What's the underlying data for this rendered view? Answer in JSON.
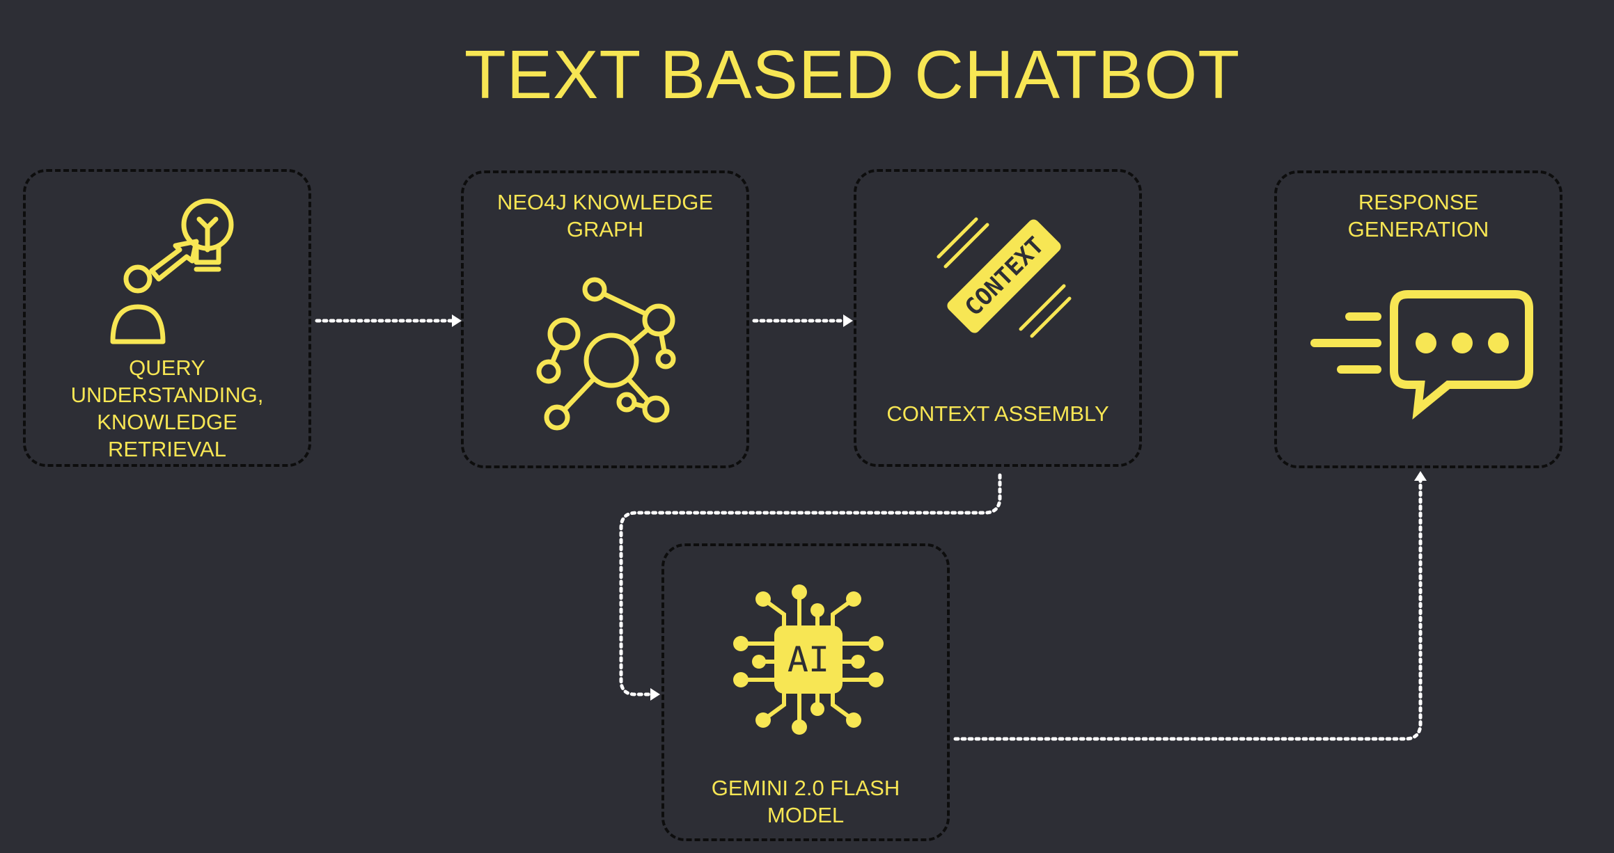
{
  "title": "TEXT BASED CHATBOT",
  "colors": {
    "background": "#2d2e35",
    "accent": "#f7e654",
    "border": "#0d0d0d",
    "connector": "#ffffff"
  },
  "nodes": [
    {
      "label": "QUERY UNDERSTANDING, KNOWLEDGE RETRIEVAL",
      "icon": "user-idea-icon"
    },
    {
      "label": "NEO4J KNOWLEDGE GRAPH",
      "icon": "network-graph-icon"
    },
    {
      "label": "CONTEXT ASSEMBLY",
      "icon": "context-stamp-icon",
      "icon_text": "CONTEXT"
    },
    {
      "label": "RESPONSE GENERATION",
      "icon": "chat-bubble-icon"
    },
    {
      "label": "GEMINI 2.0 FLASH MODEL",
      "icon": "ai-chip-icon",
      "icon_text": "AI"
    }
  ]
}
